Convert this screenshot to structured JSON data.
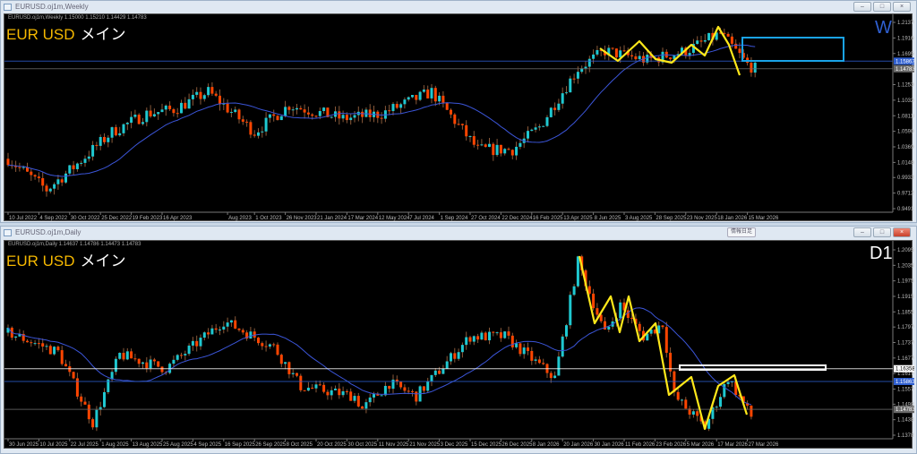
{
  "top": {
    "window_title": "EURUSD.oj1m,Weekly",
    "info": "EURUSD.oj1m,Weekly  1.15000 1.15210 1.14429 1.14783",
    "label_main": "EUR USD",
    "label_sub": "メイン",
    "timeframe": "W",
    "price_labels": [
      "1.21370",
      "1.19160",
      "1.16950",
      "1.12530",
      "1.10320",
      "1.08110",
      "1.05900",
      "1.03690",
      "1.01480",
      "0.99335",
      "0.97125",
      "0.94915"
    ],
    "price_tags": [
      {
        "text": "1.15863",
        "color": "#2f5fd0"
      },
      {
        "text": "1.14783",
        "color": "#6b6b6b"
      }
    ],
    "date_labels": [
      {
        "t": "10 Jul 2022",
        "bar": 0
      },
      {
        "t": "4 Sep 2022",
        "bar": 8
      },
      {
        "t": "30 Oct 2022",
        "bar": 16
      },
      {
        "t": "25 Dec 2022",
        "bar": 24
      },
      {
        "t": "19 Feb 2023",
        "bar": 32
      },
      {
        "t": "16 Apr 2023",
        "bar": 40
      },
      {
        "t": "Aug 2023",
        "bar": 57
      },
      {
        "t": "1 Oct 2023",
        "bar": 64
      },
      {
        "t": "26 Nov 2023",
        "bar": 72
      },
      {
        "t": "21 Jan 2024",
        "bar": 80
      },
      {
        "t": "17 Mar 2024",
        "bar": 88
      },
      {
        "t": "12 May 2024",
        "bar": 96
      },
      {
        "t": "7 Jul 2024",
        "bar": 104
      },
      {
        "t": "1 Sep 2024",
        "bar": 112
      },
      {
        "t": "27 Oct 2024",
        "bar": 120
      },
      {
        "t": "22 Dec 2024",
        "bar": 128
      },
      {
        "t": "16 Feb 2025",
        "bar": 136
      },
      {
        "t": "13 Apr 2025",
        "bar": 144
      },
      {
        "t": "8 Jun 2025",
        "bar": 152
      },
      {
        "t": "3 Aug 2025",
        "bar": 160
      },
      {
        "t": "28 Sep 2025",
        "bar": 168
      },
      {
        "t": "23 Nov 2025",
        "bar": 176
      },
      {
        "t": "18 Jan 2026",
        "bar": 184
      },
      {
        "t": "15 Mar 2026",
        "bar": 192
      }
    ],
    "anchors": [
      [
        0,
        1.02
      ],
      [
        10,
        0.976
      ],
      [
        17,
        1.008
      ],
      [
        27,
        1.058
      ],
      [
        36,
        1.084
      ],
      [
        43,
        1.09
      ],
      [
        52,
        1.115
      ],
      [
        64,
        1.058
      ],
      [
        73,
        1.096
      ],
      [
        87,
        1.077
      ],
      [
        97,
        1.084
      ],
      [
        110,
        1.115
      ],
      [
        122,
        1.033
      ],
      [
        131,
        1.033
      ],
      [
        138,
        1.065
      ],
      [
        148,
        1.148
      ],
      [
        155,
        1.173
      ],
      [
        166,
        1.16
      ],
      [
        176,
        1.173
      ],
      [
        185,
        1.198
      ],
      [
        192,
        1.154
      ],
      [
        194,
        1.148
      ]
    ]
  },
  "bottom": {
    "window_title": "EURUSD.oj1m,Daily",
    "info": "EURUSD.oj1m,Daily  1.14637 1.14786 1.14473 1.14783",
    "label_main": "EUR USD",
    "label_sub": "メイン",
    "timeframe": "D1",
    "popup_button": "情報日足",
    "price_labels": [
      "1.20955",
      "1.20355",
      "1.19755",
      "1.19155",
      "1.18555",
      "1.17970",
      "1.17370",
      "1.16770",
      "1.16170",
      "1.15570",
      "1.14985",
      "1.14385",
      "1.13785"
    ],
    "price_tags": [
      {
        "text": "1.16358",
        "color": "#ffffff"
      },
      {
        "text": "1.15863",
        "color": "#2f5fd0"
      },
      {
        "text": "1.14783",
        "color": "#6b6b6b"
      }
    ],
    "date_labels": [
      {
        "t": "30 Jun 2025",
        "bar": 0
      },
      {
        "t": "10 Jul 2025",
        "bar": 8
      },
      {
        "t": "22 Jul 2025",
        "bar": 16
      },
      {
        "t": "1 Aug 2025",
        "bar": 24
      },
      {
        "t": "13 Aug 2025",
        "bar": 32
      },
      {
        "t": "25 Aug 2025",
        "bar": 40
      },
      {
        "t": "4 Sep 2025",
        "bar": 48
      },
      {
        "t": "16 Sep 2025",
        "bar": 56
      },
      {
        "t": "26 Sep 2025",
        "bar": 64
      },
      {
        "t": "8 Oct 2025",
        "bar": 72
      },
      {
        "t": "20 Oct 2025",
        "bar": 80
      },
      {
        "t": "30 Oct 2025",
        "bar": 88
      },
      {
        "t": "11 Nov 2025",
        "bar": 96
      },
      {
        "t": "21 Nov 2025",
        "bar": 104
      },
      {
        "t": "3 Dec 2025",
        "bar": 112
      },
      {
        "t": "15 Dec 2025",
        "bar": 120
      },
      {
        "t": "26 Dec 2025",
        "bar": 128
      },
      {
        "t": "8 Jan 2026",
        "bar": 136
      },
      {
        "t": "20 Jan 2026",
        "bar": 144
      },
      {
        "t": "30 Jan 2026",
        "bar": 152
      },
      {
        "t": "11 Feb 2026",
        "bar": 160
      },
      {
        "t": "23 Feb 2026",
        "bar": 168
      },
      {
        "t": "5 Mar 2026",
        "bar": 176
      },
      {
        "t": "17 Mar 2026",
        "bar": 184
      },
      {
        "t": "27 Mar 2026",
        "bar": 192
      }
    ],
    "anchors": [
      [
        0,
        1.1775
      ],
      [
        13,
        1.17
      ],
      [
        22,
        1.1427
      ],
      [
        29,
        1.169
      ],
      [
        41,
        1.1636
      ],
      [
        56,
        1.182
      ],
      [
        69,
        1.172
      ],
      [
        76,
        1.1567
      ],
      [
        90,
        1.153
      ],
      [
        92,
        1.148
      ],
      [
        99,
        1.158
      ],
      [
        106,
        1.153
      ],
      [
        120,
        1.176
      ],
      [
        129,
        1.176
      ],
      [
        142,
        1.16
      ],
      [
        148,
        1.205
      ],
      [
        155,
        1.177
      ],
      [
        159,
        1.188
      ],
      [
        165,
        1.176
      ],
      [
        170,
        1.181
      ],
      [
        173,
        1.153
      ],
      [
        181,
        1.141
      ],
      [
        187,
        1.16
      ],
      [
        193,
        1.145
      ]
    ]
  },
  "colors": {
    "up": "#1fc8d0",
    "down": "#ff4500",
    "ma": "#3b55d8",
    "zigzag": "#ffe81a",
    "box_w": "#1aa3e8",
    "box_d": "#ffffff"
  }
}
